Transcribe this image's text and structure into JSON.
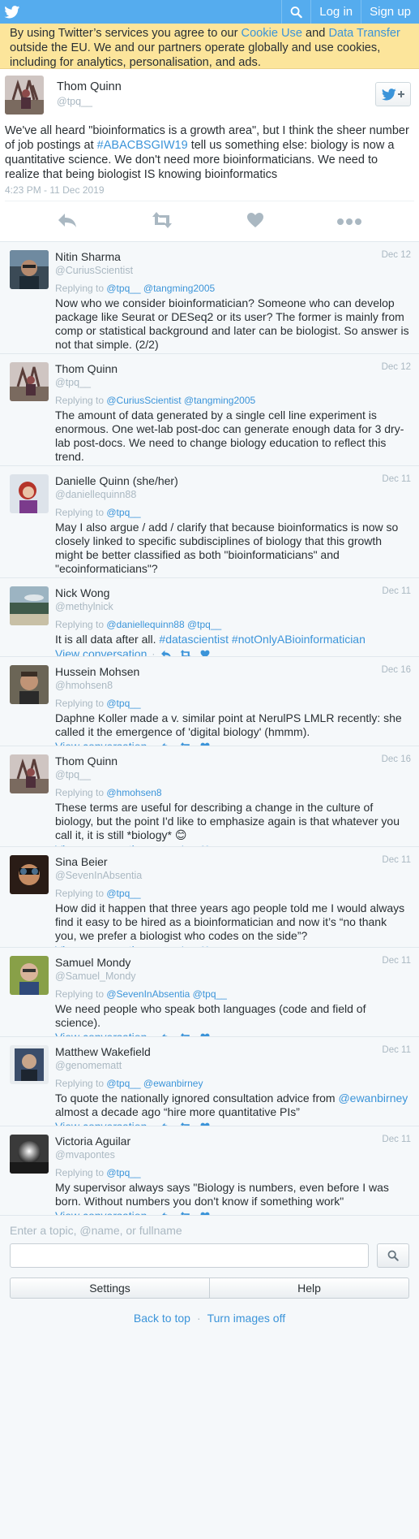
{
  "colors": {
    "brand": "#55acee",
    "link": "#3b94d9",
    "banner": "#fce59b",
    "muted": "#aab8c2"
  },
  "topbar": {
    "logo_icon": "twitter-bird-icon",
    "search_icon": "search-icon",
    "login": "Log in",
    "signup": "Sign up"
  },
  "cookie": {
    "t1": "By using Twitter’s services you agree to our ",
    "l1": "Cookie Use",
    "t2": " and ",
    "l2": "Data Transfer",
    "t3": " outside the EU. We and our partners operate globally and use cookies, including for analytics, personalisation, and ads."
  },
  "main": {
    "fullname": "Thom Quinn",
    "username": "@tpq__",
    "text_a": "We've all heard \"bioinformatics is a growth area\", but I think the sheer number of job postings at ",
    "hashtag": "#ABACBSGIW19",
    "text_b": " tell us something else: biology is now a quantitative science. We don't need more bioinformaticians. We need to realize that being biologist IS knowing bioinformatics",
    "time": "4:23 PM - 11 Dec 2019"
  },
  "labels": {
    "replying": "Replying to ",
    "view": "View conversation",
    "dot": "·"
  },
  "replies": [
    {
      "fullname": "Nitin Sharma",
      "username": "@CuriusScientist",
      "date": "Dec 12",
      "replying": "@tpq__ @tangming2005",
      "text": "Now who we consider bioinformatician? Someone who can develop package like Seurat or DESeq2 or its user? The former is mainly from comp or statistical background and later can be biologist. So answer is not that simple. (2/2)"
    },
    {
      "fullname": "Thom Quinn",
      "username": "@tpq__",
      "date": "Dec 12",
      "replying": "@CuriusScientist @tangming2005",
      "text": "The amount of data generated by a single cell line experiment is enormous. One wet-lab post-doc can generate enough data for 3 dry-lab post-docs. We need to change biology education to reflect this trend."
    },
    {
      "fullname": "Danielle Quinn (she/her)",
      "username": "@daniellequinn88",
      "date": "Dec 11",
      "replying": "@tpq__",
      "text": "May I also argue / add / clarify that because bioinformatics is now so closely linked to specific subdisciplines of biology that this growth might be better classified as both \"bioinformaticians\" and \"ecoinformaticians\"?"
    },
    {
      "fullname": "Nick Wong",
      "username": "@methylnick",
      "date": "Dec 11",
      "replying": "@daniellequinn88 @tpq__",
      "text": "It is all data after all. ",
      "tags": "#datascientist #notOnlyABioinformatician"
    },
    {
      "fullname": "Hussein Mohsen",
      "username": "@hmohsen8",
      "date": "Dec 16",
      "replying": "@tpq__",
      "text": "Daphne Koller made a v. similar point at NerulPS LMLR recently: she called it the emergence of 'digital biology' (hmmm)."
    },
    {
      "fullname": "Thom Quinn",
      "username": "@tpq__",
      "date": "Dec 16",
      "replying": "@hmohsen8",
      "text": "These terms are useful for describing a change in the culture of biology, but the point I'd like to emphasize again is that whatever you call it, it is still *biology* 😊"
    },
    {
      "fullname": "Sina Beier",
      "username": "@SevenInAbsentia",
      "date": "Dec 11",
      "replying": "@tpq__",
      "text": "How did it happen that three years ago people told me I would always find it easy to be hired as a bioinformatician and now it’s “no thank you, we prefer a biologist who codes on the side”?"
    },
    {
      "fullname": "Samuel Mondy",
      "username": "@Samuel_Mondy",
      "date": "Dec 11",
      "replying": "@SevenInAbsentia @tpq__",
      "text": "We need people who speak both languages (code and field of science)."
    },
    {
      "fullname": "Matthew Wakefield",
      "username": "@genomematt",
      "date": "Dec 11",
      "replying": "@tpq__ @ewanbirney",
      "text": "To quote the nationally ignored consultation advice from ",
      "mention": "@ewanbirney",
      "text2": " almost a decade ago “hire more quantitative PIs”"
    },
    {
      "fullname": "Victoria Aguilar",
      "username": "@mvapontes",
      "date": "Dec 11",
      "replying": "@tpq__",
      "text": "My supervisor always says \"Biology is numbers, even before I was born. Without numbers you don't know if something work\""
    }
  ],
  "footer": {
    "hint": "Enter a topic, @name, or fullname",
    "search_icon": "search-icon",
    "settings": "Settings",
    "help": "Help",
    "back_to_top": "Back to top",
    "sep": "·",
    "images_off": "Turn images off"
  }
}
